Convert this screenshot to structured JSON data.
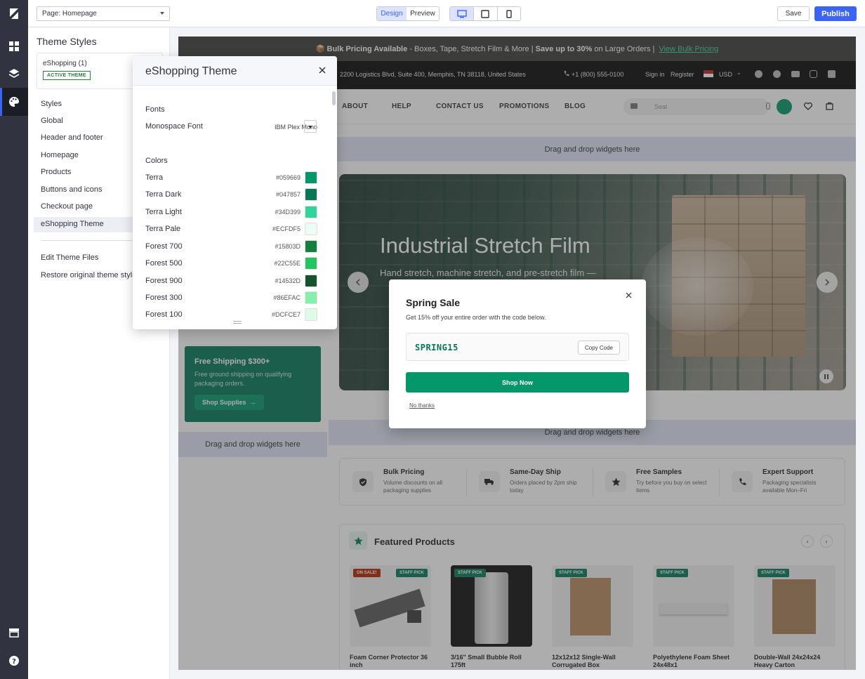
{
  "topbar": {
    "page_select": "Page: Homepage",
    "mode_design": "Design",
    "mode_preview": "Preview",
    "save": "Save",
    "publish": "Publish"
  },
  "sidebar": {
    "title": "Theme Styles",
    "theme_name": "eShopping (1)",
    "active_badge": "ACTIVE THEME",
    "items": [
      "Styles",
      "Global",
      "Header and footer",
      "Homepage",
      "Products",
      "Buttons and icons",
      "Checkout page",
      "eShopping Theme"
    ],
    "lower_items": [
      "Edit Theme Files",
      "Restore original theme styles"
    ]
  },
  "panel": {
    "title": "eShopping Theme",
    "fonts_label": "Fonts",
    "monospace_label": "Monospace Font",
    "monospace_value": "IBM Plex Mono",
    "colors_label": "Colors",
    "colors": [
      {
        "name": "Terra",
        "hex": "#059669"
      },
      {
        "name": "Terra Dark",
        "hex": "#047857"
      },
      {
        "name": "Terra Light",
        "hex": "#34D399"
      },
      {
        "name": "Terra Pale",
        "hex": "#ECFDF5"
      },
      {
        "name": "Forest 700",
        "hex": "#15803D"
      },
      {
        "name": "Forest 500",
        "hex": "#22C55E"
      },
      {
        "name": "Forest 900",
        "hex": "#14532D"
      },
      {
        "name": "Forest 300",
        "hex": "#86EFAC"
      },
      {
        "name": "Forest 100",
        "hex": "#DCFCE7"
      }
    ]
  },
  "store": {
    "announcement": {
      "icon": "📦",
      "part1": "Bulk Pricing Available",
      "part2": " - Boxes, Tape, Stretch Film & More  |  ",
      "part3": "Save up to 30%",
      "part4": " on Large Orders  |  ",
      "link": "View Bulk Pricing"
    },
    "utility": {
      "address": "2200 Logistics Blvd, Suite 400, Memphis, TN 38118, United States",
      "phone": "+1 (800) 555-0100",
      "signin": "Sign in",
      "register": "Register",
      "currency": "USD"
    },
    "nav": [
      "ABOUT",
      "HELP",
      "CONTACT US",
      "PROMOTIONS",
      "BLOG"
    ],
    "search_placeholder": "Seal",
    "dnd_label": "Drag and drop widgets here",
    "hero": {
      "title": "Industrial Stretch Film",
      "subtitle": "Hand stretch, machine stretch, and pre-stretch film —"
    },
    "promo": {
      "title": "Free Shipping $300+",
      "desc": "Free ground shipping on qualifying packaging orders.",
      "button": "Shop Supplies"
    },
    "features": [
      {
        "title": "Bulk Pricing",
        "desc": "Volume discounts on all packaging supplies",
        "icon": "shield-check-icon"
      },
      {
        "title": "Same-Day Ship",
        "desc": "Orders placed by 2pm ship today",
        "icon": "truck-icon"
      },
      {
        "title": "Free Samples",
        "desc": "Try before you buy on select items",
        "icon": "star-icon"
      },
      {
        "title": "Expert Support",
        "desc": "Packaging specialists available Mon–Fri",
        "icon": "phone-icon"
      }
    ],
    "featured_title": "Featured Products",
    "products": [
      {
        "name": "Foam Corner Protector 36 inch",
        "tags": [
          "ON SALE!",
          "STAFF PICK"
        ]
      },
      {
        "name": "3/16\" Small Bubble Roll 175ft",
        "tags": [
          "STAFF PICK"
        ]
      },
      {
        "name": "12x12x12 Single-Wall Corrugated Box",
        "tags": [
          "STAFF PICK"
        ]
      },
      {
        "name": "Polyethylene Foam Sheet 24x48x1",
        "tags": [
          "STAFF PICK"
        ]
      },
      {
        "name": "Double-Wall 24x24x24 Heavy Carton",
        "tags": [
          "STAFF PICK"
        ]
      }
    ]
  },
  "popup": {
    "title": "Spring Sale",
    "subtitle": "Get 15% off your entire order with the code below.",
    "code": "SPRING15",
    "copy": "Copy Code",
    "shop": "Shop Now",
    "decline": "No thanks"
  },
  "colors": {
    "accent": "#3c64f4",
    "rail": "#313440",
    "brand": "#059669",
    "brand_dark": "#047857"
  }
}
